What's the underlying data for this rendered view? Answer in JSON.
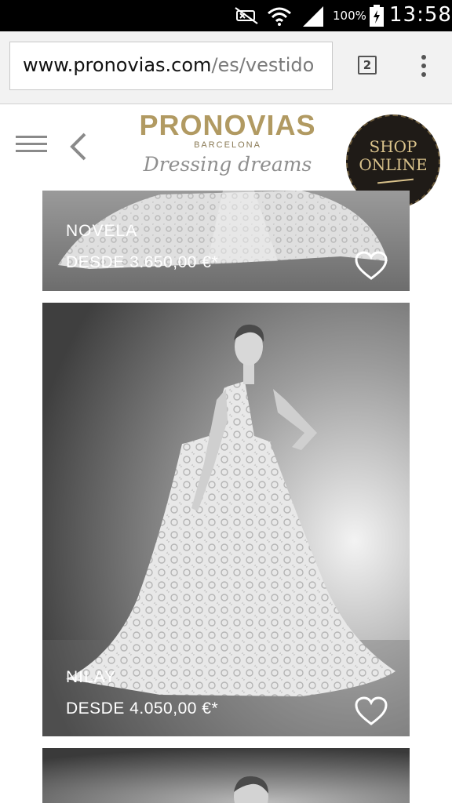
{
  "status_bar": {
    "battery": "100%",
    "time": "13:58",
    "icons": [
      "mute-icon",
      "wifi-icon",
      "signal-icon",
      "battery-icon"
    ]
  },
  "browser": {
    "url_domain": "www.pronovias.com",
    "url_path": "/es/vestido",
    "tab_count": "2",
    "icons": [
      "tabs-icon",
      "overflow-menu-icon"
    ]
  },
  "header": {
    "brand": "PRONOVIAS",
    "brand_sub": "BARCELONA",
    "tagline": "Dressing dreams",
    "shop_line1": "SHOP",
    "shop_line2": "ONLINE",
    "icons": [
      "hamburger-menu-icon",
      "back-arrow-icon"
    ]
  },
  "products": [
    {
      "name": "NOVELA",
      "price": "DESDE 3.650,00 €*"
    },
    {
      "name": "NILAY",
      "price": "DESDE 4.050,00 €*"
    }
  ],
  "colors": {
    "brand_gold": "#b19a62",
    "status_bar_bg": "#000000",
    "badge_bg": "#1f1b17"
  }
}
